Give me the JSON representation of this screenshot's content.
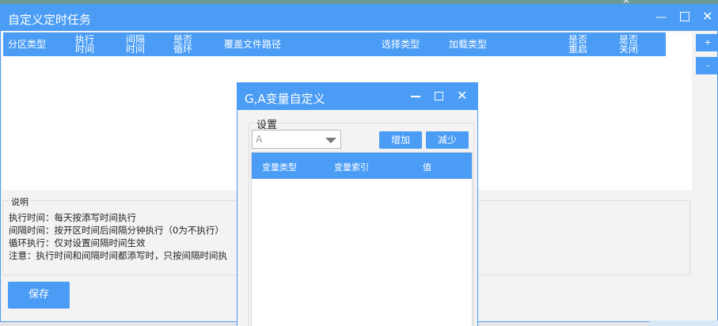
{
  "main_window": {
    "title": "自定义定时任务",
    "columns": [
      "分区类型",
      "执行时间",
      "间隔时间",
      "是否循环",
      "覆盖文件路径",
      "选择类型",
      "加载类型",
      "是否重启",
      "是否关闭"
    ],
    "add_label": "+",
    "remove_label": "-",
    "description": {
      "legend": "说明",
      "lines": [
        "执行时间：每天按添写时间执行",
        "间隔时间：按开区时间后间隔分钟执行（0为不执行）",
        "循环执行：仅对设置间隔时间生效",
        "注意：执行时间和间隔时间都添写时，只按间隔时间执"
      ]
    },
    "save_label": "保存",
    "top_close": "×"
  },
  "dialog": {
    "title": "G,A变量自定义",
    "settings_legend": "设置",
    "combo_value": "A",
    "add_label": "增加",
    "reduce_label": "减少",
    "columns": [
      "变量类型",
      "变量索引",
      "值"
    ]
  },
  "colors": {
    "accent": "#4a9cf5",
    "background": "#f3f3f3"
  },
  "icons": [
    "minimize-icon",
    "maximize-icon",
    "close-icon",
    "dropdown-arrow-icon"
  ]
}
